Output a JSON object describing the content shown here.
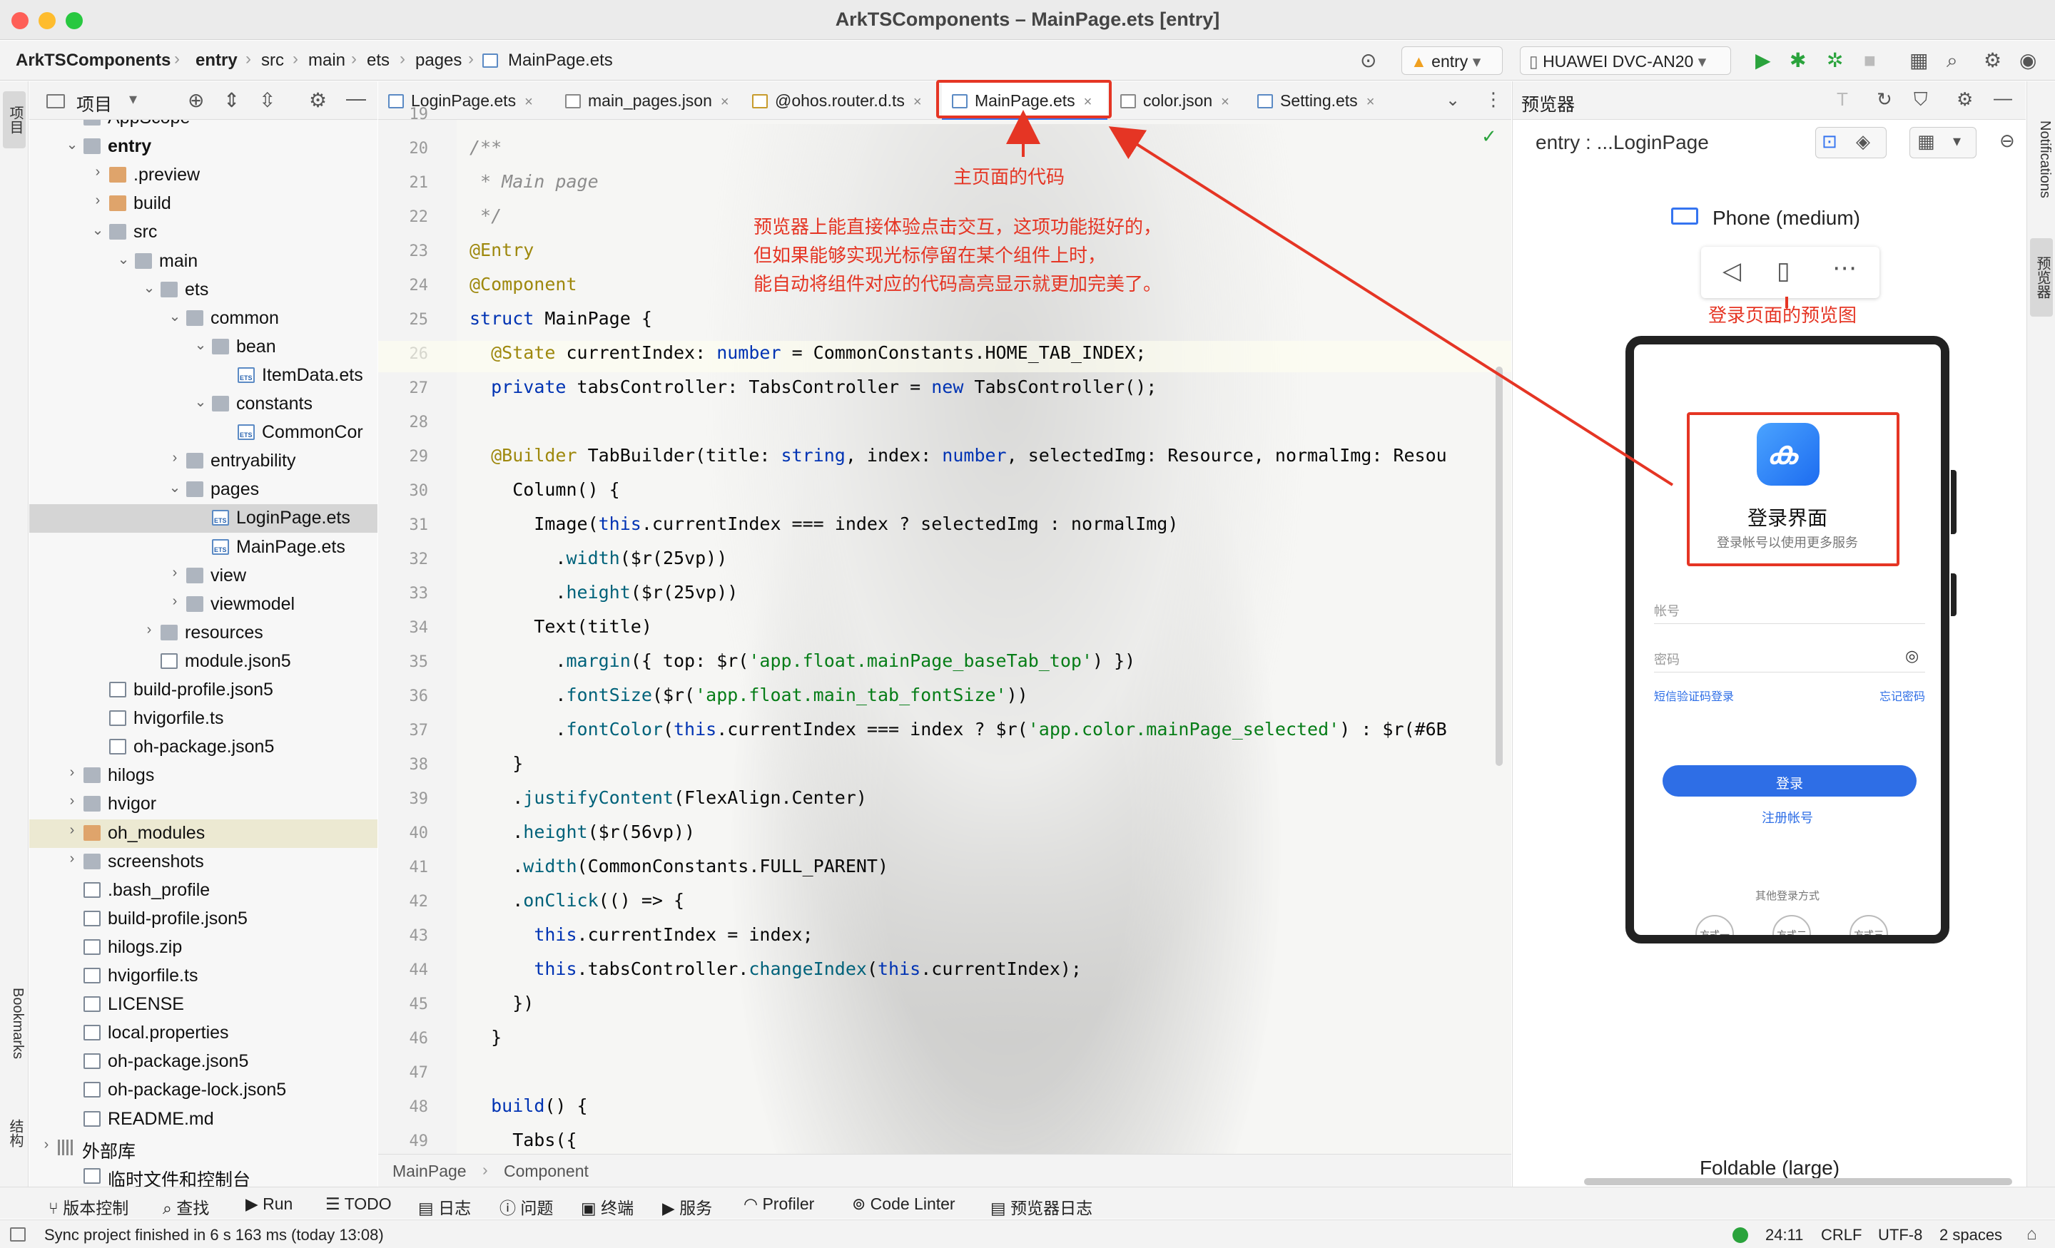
{
  "window": {
    "title": "ArkTSComponents – MainPage.ets [entry]"
  },
  "breadcrumb": [
    "ArkTSComponents",
    "entry",
    "src",
    "main",
    "ets",
    "pages",
    "MainPage.ets"
  ],
  "toolbar": {
    "run_config": "entry",
    "device": "HUAWEI DVC-AN20"
  },
  "left_strip": {
    "project": "项目",
    "bookmarks": "Bookmarks",
    "structure": "结构"
  },
  "project_panel": {
    "title": "项目",
    "tree": [
      {
        "label": "AppScope",
        "kind": "folder"
      },
      {
        "label": "entry",
        "kind": "folder"
      },
      {
        "label": ".preview",
        "kind": "folder-orange"
      },
      {
        "label": "build",
        "kind": "folder-orange"
      },
      {
        "label": "src",
        "kind": "folder"
      },
      {
        "label": "main",
        "kind": "folder"
      },
      {
        "label": "ets",
        "kind": "folder"
      },
      {
        "label": "common",
        "kind": "folder"
      },
      {
        "label": "bean",
        "kind": "folder"
      },
      {
        "label": "ItemData.ets",
        "kind": "ets"
      },
      {
        "label": "constants",
        "kind": "folder"
      },
      {
        "label": "CommonCor",
        "kind": "ets"
      },
      {
        "label": "entryability",
        "kind": "folder"
      },
      {
        "label": "pages",
        "kind": "folder"
      },
      {
        "label": "LoginPage.ets",
        "kind": "ets"
      },
      {
        "label": "MainPage.ets",
        "kind": "ets"
      },
      {
        "label": "view",
        "kind": "folder"
      },
      {
        "label": "viewmodel",
        "kind": "folder"
      },
      {
        "label": "resources",
        "kind": "folder"
      },
      {
        "label": "module.json5",
        "kind": "file"
      },
      {
        "label": "build-profile.json5",
        "kind": "file"
      },
      {
        "label": "hvigorfile.ts",
        "kind": "file"
      },
      {
        "label": "oh-package.json5",
        "kind": "file"
      },
      {
        "label": "hilogs",
        "kind": "folder"
      },
      {
        "label": "hvigor",
        "kind": "folder"
      },
      {
        "label": "oh_modules",
        "kind": "folder-orange"
      },
      {
        "label": "screenshots",
        "kind": "folder"
      },
      {
        "label": ".bash_profile",
        "kind": "file"
      },
      {
        "label": "build-profile.json5",
        "kind": "file"
      },
      {
        "label": "hilogs.zip",
        "kind": "file"
      },
      {
        "label": "hvigorfile.ts",
        "kind": "file"
      },
      {
        "label": "LICENSE",
        "kind": "file"
      },
      {
        "label": "local.properties",
        "kind": "file"
      },
      {
        "label": "oh-package.json5",
        "kind": "file"
      },
      {
        "label": "oh-package-lock.json5",
        "kind": "file"
      },
      {
        "label": "README.md",
        "kind": "file"
      },
      {
        "label": "外部库",
        "kind": "lib"
      },
      {
        "label": "临时文件和控制台",
        "kind": "file"
      }
    ]
  },
  "editor_tabs": [
    "LoginPage.ets",
    "main_pages.json",
    "@ohos.router.d.ts",
    "MainPage.ets",
    "color.json",
    "Setting.ets"
  ],
  "code": [
    {
      "n": "19",
      "t": ""
    },
    {
      "n": "20",
      "t": "/**"
    },
    {
      "n": "21",
      "t": " * Main page"
    },
    {
      "n": "22",
      "t": " */"
    },
    {
      "n": "23",
      "t": "@Entry"
    },
    {
      "n": "24",
      "t": "@Component"
    },
    {
      "n": "25",
      "t": "struct MainPage {"
    },
    {
      "n": "26",
      "t": "  @State currentIndex: number = CommonConstants.HOME_TAB_INDEX;"
    },
    {
      "n": "27",
      "t": "  private tabsController: TabsController = new TabsController();"
    },
    {
      "n": "28",
      "t": ""
    },
    {
      "n": "29",
      "t": "  @Builder TabBuilder(title: string, index: number, selectedImg: Resource, normalImg: Resou"
    },
    {
      "n": "30",
      "t": "    Column() {"
    },
    {
      "n": "31",
      "t": "      Image(this.currentIndex === index ? selectedImg : normalImg)"
    },
    {
      "n": "32",
      "t": "        .width($r(25vp))"
    },
    {
      "n": "33",
      "t": "        .height($r(25vp))"
    },
    {
      "n": "34",
      "t": "      Text(title)"
    },
    {
      "n": "35",
      "t": "        .margin({ top: $r('app.float.mainPage_baseTab_top') })"
    },
    {
      "n": "36",
      "t": "        .fontSize($r('app.float.main_tab_fontSize'))"
    },
    {
      "n": "37",
      "t": "        .fontColor(this.currentIndex === index ? $r('app.color.mainPage_selected') : $r(#6B"
    },
    {
      "n": "38",
      "t": "    }"
    },
    {
      "n": "39",
      "t": "    .justifyContent(FlexAlign.Center)"
    },
    {
      "n": "40",
      "t": "    .height($r(56vp))"
    },
    {
      "n": "41",
      "t": "    .width(CommonConstants.FULL_PARENT)"
    },
    {
      "n": "42",
      "t": "    .onClick(() => {"
    },
    {
      "n": "43",
      "t": "      this.currentIndex = index;"
    },
    {
      "n": "44",
      "t": "      this.tabsController.changeIndex(this.currentIndex);"
    },
    {
      "n": "45",
      "t": "    })"
    },
    {
      "n": "46",
      "t": "  }"
    },
    {
      "n": "47",
      "t": ""
    },
    {
      "n": "48",
      "t": "  build() {"
    },
    {
      "n": "49",
      "t": "    Tabs({"
    },
    {
      "n": "50",
      "t": "      barPosition: BarPosition.End,"
    },
    {
      "n": "51",
      "t": "      controller: this.tabsController"
    }
  ],
  "editor_breadcrumb": {
    "a": "MainPage",
    "b": "Component"
  },
  "annotations": {
    "main_code": "主页面的代码",
    "note_line1": "预览器上能直接体验点击交互，这项功能挺好的，",
    "note_line2": "但如果能够实现光标停留在某个组件上时，",
    "note_line3": "能自动将组件对应的代码高亮显示就更加完美了。",
    "login_preview": "登录页面的预览图"
  },
  "previewer": {
    "title": "预览器",
    "page": "entry : ...LoginPage",
    "device_label": "Phone (medium)",
    "foldable_label": "Foldable (large)",
    "notifications": "Notifications",
    "side_label": "预览器"
  },
  "login": {
    "title": "登录界面",
    "subtitle": "登录帐号以使用更多服务",
    "account_placeholder": "帐号",
    "password_placeholder": "密码",
    "sms_login": "短信验证码登录",
    "forgot": "忘记密码",
    "login_button": "登录",
    "register": "注册帐号",
    "other_methods": "其他登录方式",
    "methods": [
      "方式一",
      "方式二",
      "方式三"
    ]
  },
  "bottom_tools": [
    "版本控制",
    "查找",
    "Run",
    "TODO",
    "日志",
    "问题",
    "终端",
    "服务",
    "Profiler",
    "Code Linter",
    "预览器日志"
  ],
  "status": {
    "message": "Sync project finished in 6 s 163 ms (today 13:08)",
    "position": "24:11",
    "line_sep": "CRLF",
    "encoding": "UTF-8",
    "indent": "2 spaces"
  },
  "colors": {
    "accent": "#3574f0",
    "annotation": "#e53524",
    "login_button": "#2e6ee6"
  }
}
